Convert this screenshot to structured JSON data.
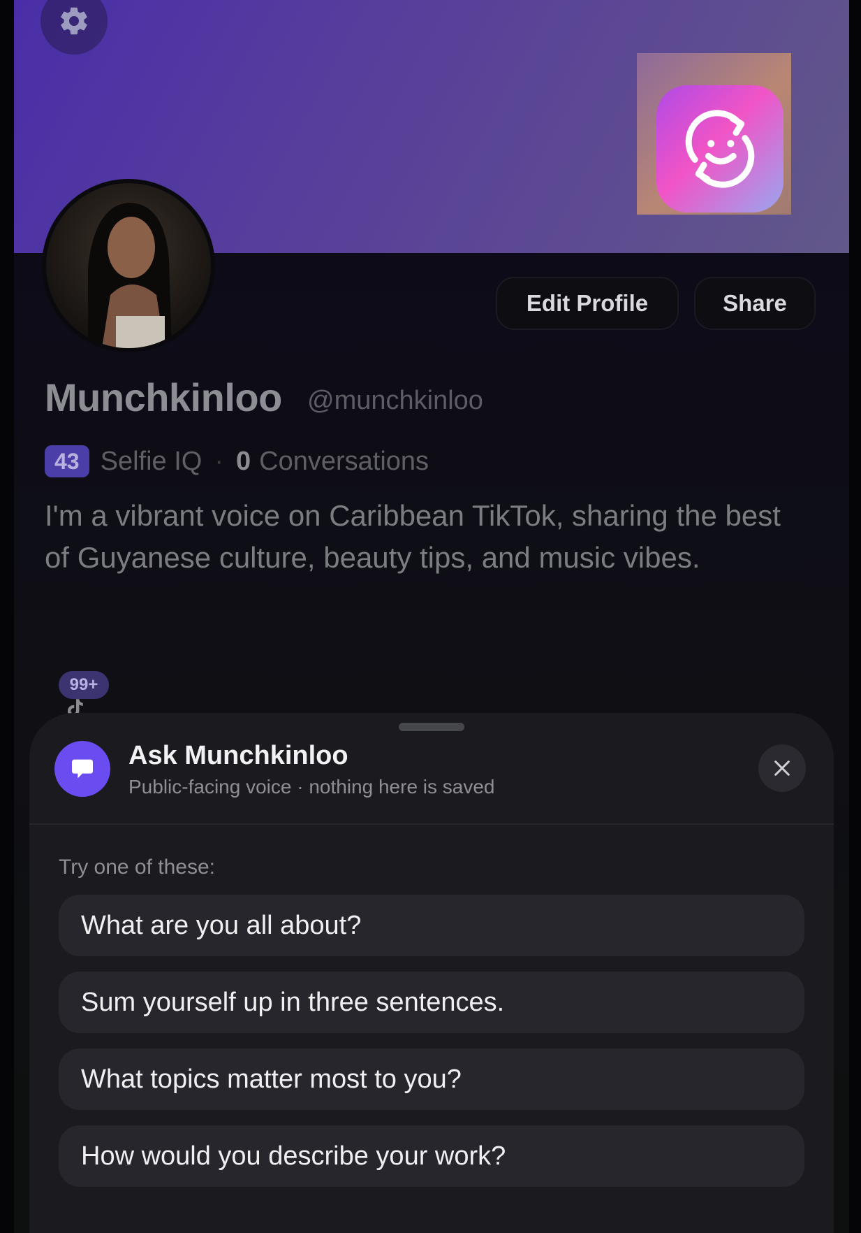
{
  "profile": {
    "name": "Munchkinloo",
    "handle": "@munchkinloo",
    "selfie_iq_value": "43",
    "selfie_iq_label": "Selfie IQ",
    "separator": "·",
    "conversations_count": "0",
    "conversations_label": "Conversations",
    "bio": "I'm a vibrant voice on Caribbean TikTok, sharing the best of Guyanese culture, beauty tips, and music vibes.",
    "notification_badge": "99+"
  },
  "actions": {
    "edit_profile": "Edit Profile",
    "share": "Share"
  },
  "ask_sheet": {
    "title": "Ask Munchkinloo",
    "subtitle": "Public-facing voice · nothing here is saved",
    "try_label": "Try one of these:",
    "suggestions": [
      "What are you all about?",
      "Sum yourself up in three sentences.",
      "What topics matter most to you?",
      "How would you describe your work?"
    ]
  },
  "icons": {
    "settings": "gear-icon",
    "app": "smiley-refresh-app-icon",
    "chat": "chat-bubble-icon",
    "close": "close-icon",
    "social": "tiktok-icon"
  },
  "colors": {
    "banner_start": "#4a2ea8",
    "banner_end": "#625889",
    "accent": "#6a4cf0",
    "iq_badge": "#4b3ea8",
    "sheet_bg": "#1a1a1f"
  }
}
